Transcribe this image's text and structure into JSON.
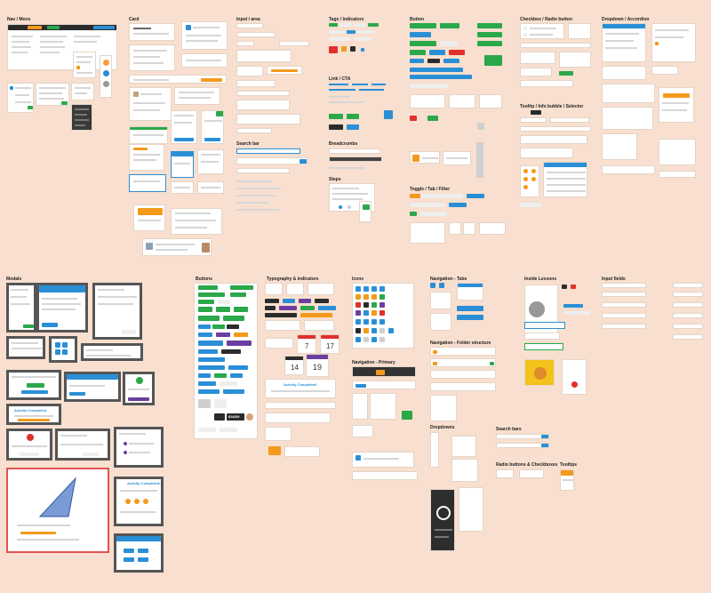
{
  "sections": {
    "nav_menu": "Nav / Menu",
    "card": "Card",
    "input_area": "Input / area",
    "tags": "Tags / Indicators",
    "button_top": "Button",
    "checkbox_radio": "Checkbox / Radio button",
    "dropdown_accordion": "Dropdown / Accordion",
    "link_cta": "Link / CTA",
    "tooltip_selector": "Tooltip / Info bubble / Selector",
    "search_bar": "Search bar",
    "breadcrumbs": "Breadcrumbs",
    "steps": "Steps",
    "toggle_tab_filter": "Toggle / Tab / Filter",
    "modals": "Modals",
    "buttons": "Buttons",
    "typography": "Typography & indicators",
    "icons": "Icons",
    "navigation_tabs": "Navigation - Tabs",
    "inside_lessons": "Inside Lessons",
    "input_fields": "Input fields",
    "navigation_folder": "Navigation - Folder structure",
    "navigation_primary": "Navigation - Primary",
    "dropdowns": "Dropdowns",
    "search_bars": "Search bars",
    "radio_checkboxes": "Radio buttons & Checkboxes",
    "tooltips": "Tooltips"
  },
  "widgets": {
    "activity_completed_1": "Activity Completed",
    "activity_completed_2": "Activity Completed!",
    "activity_completed_3": "Activity Completed!",
    "dash_label": "iDASH",
    "date_a": "7",
    "date_b": "19",
    "date_c": "14",
    "date_d": "17"
  },
  "colors": {
    "background": "#f8dfcf",
    "primary_blue": "#2a8fd6",
    "success_green": "#2aa84a",
    "accent_orange": "#f39a1d",
    "danger_red": "#e0302c",
    "dark": "#2b2b2b"
  }
}
